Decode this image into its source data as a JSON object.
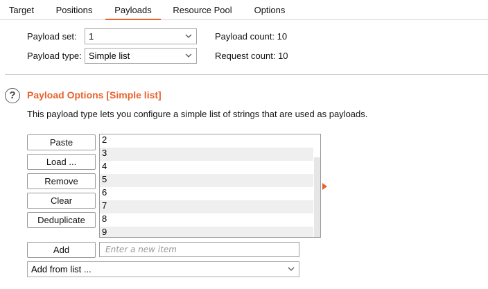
{
  "tabs": [
    {
      "label": "Target"
    },
    {
      "label": "Positions"
    },
    {
      "label": "Payloads",
      "active": true
    },
    {
      "label": "Resource Pool"
    },
    {
      "label": "Options"
    }
  ],
  "payload_set": {
    "label": "Payload set:",
    "value": "1"
  },
  "payload_type": {
    "label": "Payload type:",
    "value": "Simple list"
  },
  "payload_count": {
    "label": "Payload count:",
    "value": "10"
  },
  "request_count": {
    "label": "Request count:",
    "value": "10"
  },
  "section": {
    "title": "Payload Options [Simple list]",
    "description": "This payload type lets you configure a simple list of strings that are used as payloads.",
    "help_icon": "question-circle-icon"
  },
  "buttons": {
    "paste": "Paste",
    "load": "Load ...",
    "remove": "Remove",
    "clear": "Clear",
    "deduplicate": "Deduplicate",
    "add": "Add"
  },
  "list_items": [
    "2",
    "3",
    "4",
    "5",
    "6",
    "7",
    "8",
    "9"
  ],
  "new_item": {
    "placeholder": "Enter a new item",
    "value": ""
  },
  "add_from_list": {
    "value": "Add from list ..."
  },
  "colors": {
    "accent": "#e8622c",
    "row_alt": "#efefef",
    "border": "#9a9a9a"
  }
}
